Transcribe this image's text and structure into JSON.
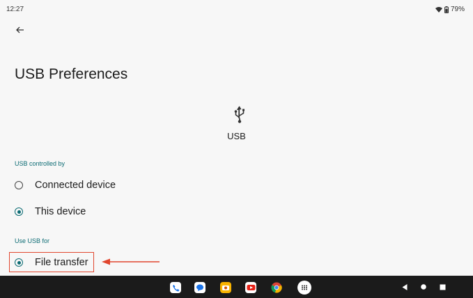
{
  "status_bar": {
    "time": "12:27",
    "battery": "79%"
  },
  "header": {
    "title": "USB Preferences"
  },
  "usb": {
    "label": "USB"
  },
  "sections": [
    {
      "header": "USB controlled by",
      "options": [
        {
          "label": "Connected device",
          "selected": false
        },
        {
          "label": "This device",
          "selected": true
        }
      ]
    },
    {
      "header": "Use USB for",
      "options": [
        {
          "label": "File transfer",
          "selected": true
        }
      ]
    }
  ],
  "dock": [
    "phone-icon",
    "messages-icon",
    "camera-icon",
    "youtube-icon",
    "chrome-icon",
    "app-drawer-icon"
  ],
  "nav": [
    "back-nav-icon",
    "home-nav-icon",
    "recents-nav-icon"
  ],
  "colors": {
    "accent": "#0b6b73",
    "annotation": "#e1462e",
    "navbar": "#1b1b1b"
  }
}
